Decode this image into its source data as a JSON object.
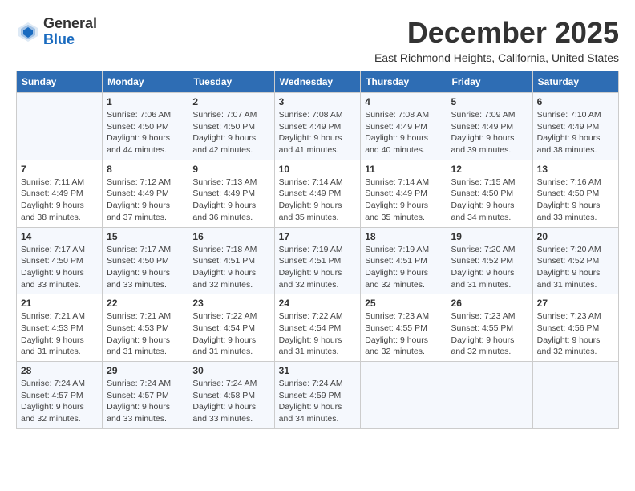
{
  "header": {
    "logo_general": "General",
    "logo_blue": "Blue",
    "month_title": "December 2025",
    "location": "East Richmond Heights, California, United States"
  },
  "days_of_week": [
    "Sunday",
    "Monday",
    "Tuesday",
    "Wednesday",
    "Thursday",
    "Friday",
    "Saturday"
  ],
  "weeks": [
    [
      {
        "day": "",
        "info": ""
      },
      {
        "day": "1",
        "info": "Sunrise: 7:06 AM\nSunset: 4:50 PM\nDaylight: 9 hours\nand 44 minutes."
      },
      {
        "day": "2",
        "info": "Sunrise: 7:07 AM\nSunset: 4:50 PM\nDaylight: 9 hours\nand 42 minutes."
      },
      {
        "day": "3",
        "info": "Sunrise: 7:08 AM\nSunset: 4:49 PM\nDaylight: 9 hours\nand 41 minutes."
      },
      {
        "day": "4",
        "info": "Sunrise: 7:08 AM\nSunset: 4:49 PM\nDaylight: 9 hours\nand 40 minutes."
      },
      {
        "day": "5",
        "info": "Sunrise: 7:09 AM\nSunset: 4:49 PM\nDaylight: 9 hours\nand 39 minutes."
      },
      {
        "day": "6",
        "info": "Sunrise: 7:10 AM\nSunset: 4:49 PM\nDaylight: 9 hours\nand 38 minutes."
      }
    ],
    [
      {
        "day": "7",
        "info": "Sunrise: 7:11 AM\nSunset: 4:49 PM\nDaylight: 9 hours\nand 38 minutes."
      },
      {
        "day": "8",
        "info": "Sunrise: 7:12 AM\nSunset: 4:49 PM\nDaylight: 9 hours\nand 37 minutes."
      },
      {
        "day": "9",
        "info": "Sunrise: 7:13 AM\nSunset: 4:49 PM\nDaylight: 9 hours\nand 36 minutes."
      },
      {
        "day": "10",
        "info": "Sunrise: 7:14 AM\nSunset: 4:49 PM\nDaylight: 9 hours\nand 35 minutes."
      },
      {
        "day": "11",
        "info": "Sunrise: 7:14 AM\nSunset: 4:49 PM\nDaylight: 9 hours\nand 35 minutes."
      },
      {
        "day": "12",
        "info": "Sunrise: 7:15 AM\nSunset: 4:50 PM\nDaylight: 9 hours\nand 34 minutes."
      },
      {
        "day": "13",
        "info": "Sunrise: 7:16 AM\nSunset: 4:50 PM\nDaylight: 9 hours\nand 33 minutes."
      }
    ],
    [
      {
        "day": "14",
        "info": "Sunrise: 7:17 AM\nSunset: 4:50 PM\nDaylight: 9 hours\nand 33 minutes."
      },
      {
        "day": "15",
        "info": "Sunrise: 7:17 AM\nSunset: 4:50 PM\nDaylight: 9 hours\nand 33 minutes."
      },
      {
        "day": "16",
        "info": "Sunrise: 7:18 AM\nSunset: 4:51 PM\nDaylight: 9 hours\nand 32 minutes."
      },
      {
        "day": "17",
        "info": "Sunrise: 7:19 AM\nSunset: 4:51 PM\nDaylight: 9 hours\nand 32 minutes."
      },
      {
        "day": "18",
        "info": "Sunrise: 7:19 AM\nSunset: 4:51 PM\nDaylight: 9 hours\nand 32 minutes."
      },
      {
        "day": "19",
        "info": "Sunrise: 7:20 AM\nSunset: 4:52 PM\nDaylight: 9 hours\nand 31 minutes."
      },
      {
        "day": "20",
        "info": "Sunrise: 7:20 AM\nSunset: 4:52 PM\nDaylight: 9 hours\nand 31 minutes."
      }
    ],
    [
      {
        "day": "21",
        "info": "Sunrise: 7:21 AM\nSunset: 4:53 PM\nDaylight: 9 hours\nand 31 minutes."
      },
      {
        "day": "22",
        "info": "Sunrise: 7:21 AM\nSunset: 4:53 PM\nDaylight: 9 hours\nand 31 minutes."
      },
      {
        "day": "23",
        "info": "Sunrise: 7:22 AM\nSunset: 4:54 PM\nDaylight: 9 hours\nand 31 minutes."
      },
      {
        "day": "24",
        "info": "Sunrise: 7:22 AM\nSunset: 4:54 PM\nDaylight: 9 hours\nand 31 minutes."
      },
      {
        "day": "25",
        "info": "Sunrise: 7:23 AM\nSunset: 4:55 PM\nDaylight: 9 hours\nand 32 minutes."
      },
      {
        "day": "26",
        "info": "Sunrise: 7:23 AM\nSunset: 4:55 PM\nDaylight: 9 hours\nand 32 minutes."
      },
      {
        "day": "27",
        "info": "Sunrise: 7:23 AM\nSunset: 4:56 PM\nDaylight: 9 hours\nand 32 minutes."
      }
    ],
    [
      {
        "day": "28",
        "info": "Sunrise: 7:24 AM\nSunset: 4:57 PM\nDaylight: 9 hours\nand 32 minutes."
      },
      {
        "day": "29",
        "info": "Sunrise: 7:24 AM\nSunset: 4:57 PM\nDaylight: 9 hours\nand 33 minutes."
      },
      {
        "day": "30",
        "info": "Sunrise: 7:24 AM\nSunset: 4:58 PM\nDaylight: 9 hours\nand 33 minutes."
      },
      {
        "day": "31",
        "info": "Sunrise: 7:24 AM\nSunset: 4:59 PM\nDaylight: 9 hours\nand 34 minutes."
      },
      {
        "day": "",
        "info": ""
      },
      {
        "day": "",
        "info": ""
      },
      {
        "day": "",
        "info": ""
      }
    ]
  ]
}
